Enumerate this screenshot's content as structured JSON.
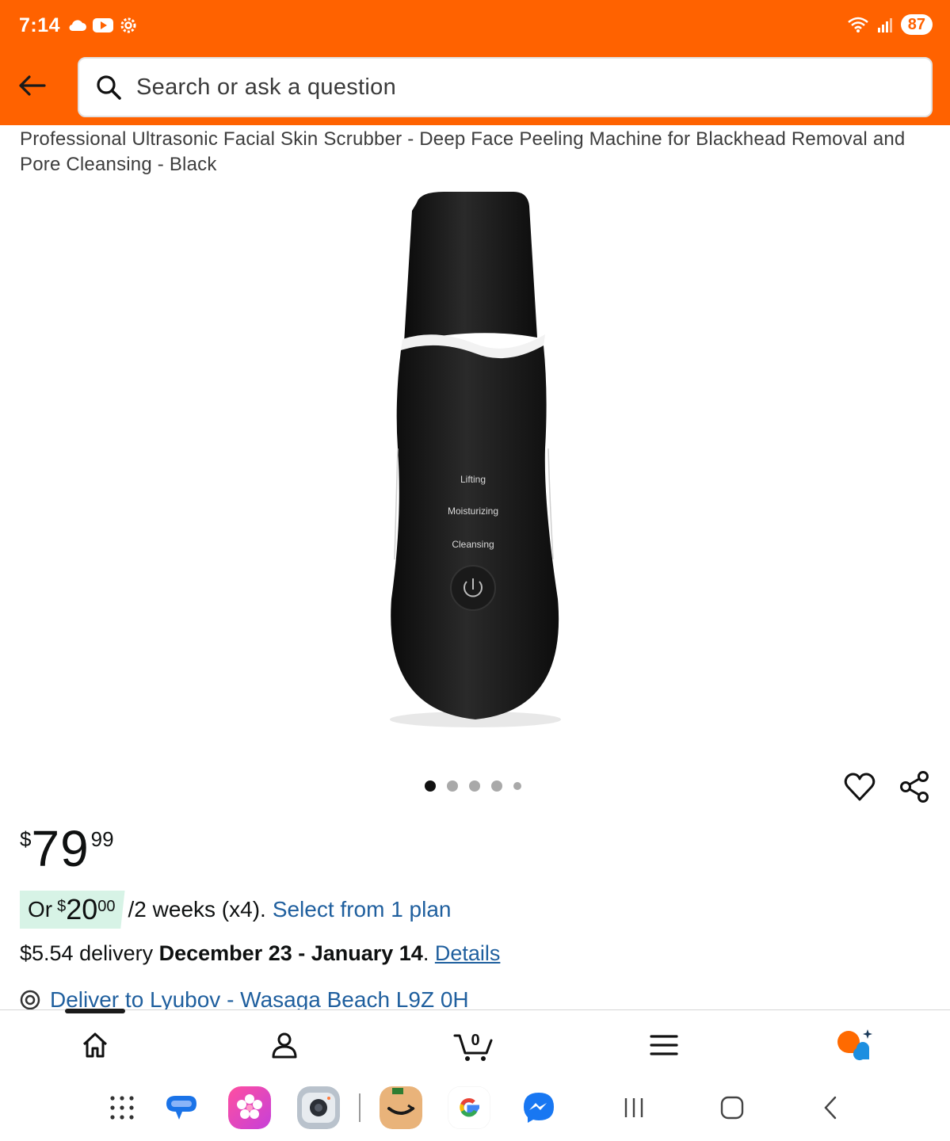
{
  "status_bar": {
    "time": "7:14",
    "battery": "87"
  },
  "search": {
    "placeholder": "Search or ask a question"
  },
  "product": {
    "title": "Professional Ultrasonic Facial Skin Scrubber - Deep Face Peeling Machine for Blackhead Removal and Pore Cleansing - Black",
    "image_labels": [
      "Lifting",
      "Moisturizing",
      "Cleansing"
    ],
    "image_count": 5,
    "active_image": 1
  },
  "price": {
    "symbol": "$",
    "whole": "79",
    "fraction": "99"
  },
  "installment": {
    "prefix": "Or",
    "symbol": "$",
    "whole": "20",
    "fraction": "00",
    "period": "/2 weeks (x4).",
    "link": "Select from 1 plan"
  },
  "delivery": {
    "cost": "$5.54 delivery",
    "dates": "December 23 - January 14",
    "separator": ".",
    "details_link": "Details"
  },
  "deliver_to": {
    "text": "Deliver to Lyubov - Wasaga Beach L9Z 0H"
  },
  "cart": {
    "count": "0"
  },
  "colors": {
    "header": "#ff6200",
    "link": "#1f5f9e",
    "installment_bg": "#d7f3e6"
  }
}
